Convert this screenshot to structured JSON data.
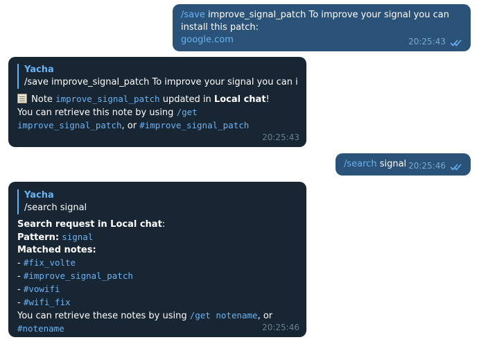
{
  "messages": [
    {
      "cmd": "/save",
      "text": " improve_signal_patch To improve your signal you can install this patch:",
      "link": "google.com",
      "time": "20:25:43"
    },
    {
      "reply_name": "Yacha",
      "reply_text": "/save improve_signal_patch To improve your signal you can inst…",
      "note_prefix": "Note",
      "note_code": "improve_signal_patch",
      "note_updated": "updated in",
      "note_chat": "Local chat",
      "note_excl": "!",
      "retrieve_prefix": "You can retrieve this note by using",
      "retrieve_cmd": "/get",
      "retrieve_code": "improve_signal_patch",
      "retrieve_or": ", or",
      "retrieve_hash": "#improve_signal_patch",
      "time": "20:25:43"
    },
    {
      "cmd": "/search",
      "text": " signal",
      "time": "20:25:46"
    },
    {
      "reply_name": "Yacha",
      "reply_text": "/search signal",
      "search_line": "Search request in Local chat",
      "search_colon": ":",
      "pattern_label": "Pattern:",
      "pattern_value": "signal",
      "matched_label": "Matched notes:",
      "notes": [
        "#fix_volte",
        "#improve_signal_patch",
        "#vowifi",
        "#wifi_fix"
      ],
      "retrieve_prefix": "You can retrieve these notes by using",
      "retrieve_cmd": "/get notename",
      "retrieve_or": ", or",
      "retrieve_hash": "#notename",
      "time": "20:25:46"
    }
  ],
  "colors": {
    "outgoing_bubble": "#2b5278",
    "incoming_bubble": "#182533",
    "accent": "#6ab3f3"
  },
  "icons": [
    "double-check-icon",
    "notepad-icon"
  ]
}
